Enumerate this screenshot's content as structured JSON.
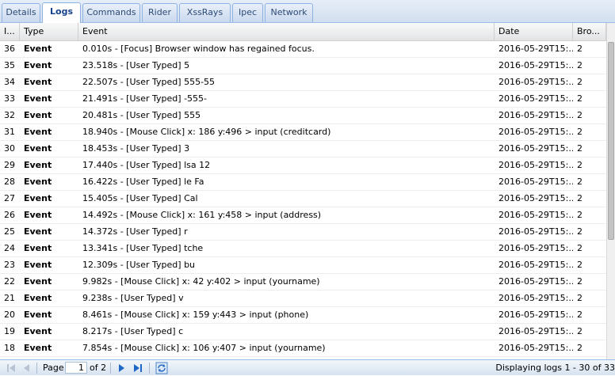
{
  "tabs": [
    {
      "label": "Details",
      "active": false
    },
    {
      "label": "Logs",
      "active": true
    },
    {
      "label": "Commands",
      "active": false
    },
    {
      "label": "Rider",
      "active": false
    },
    {
      "label": "XssRays",
      "active": false
    },
    {
      "label": "Ipec",
      "active": false
    },
    {
      "label": "Network",
      "active": false
    }
  ],
  "columns": {
    "id": "I...",
    "type": "Type",
    "event": "Event",
    "date": "Date",
    "browser": "Bro..."
  },
  "rows": [
    {
      "id": "36",
      "type": "Event",
      "event": "0.010s - [Focus] Browser window has regained focus.",
      "date": "2016-05-29T15:...",
      "browser": "2"
    },
    {
      "id": "35",
      "type": "Event",
      "event": "23.518s - [User Typed] 5",
      "date": "2016-05-29T15:...",
      "browser": "2"
    },
    {
      "id": "34",
      "type": "Event",
      "event": "22.507s - [User Typed] 555-55",
      "date": "2016-05-29T15:...",
      "browser": "2"
    },
    {
      "id": "33",
      "type": "Event",
      "event": "21.491s - [User Typed] -555-",
      "date": "2016-05-29T15:...",
      "browser": "2"
    },
    {
      "id": "32",
      "type": "Event",
      "event": "20.481s - [User Typed] 555",
      "date": "2016-05-29T15:...",
      "browser": "2"
    },
    {
      "id": "31",
      "type": "Event",
      "event": "18.940s - [Mouse Click] x: 186 y:496 > input (creditcard)",
      "date": "2016-05-29T15:...",
      "browser": "2"
    },
    {
      "id": "30",
      "type": "Event",
      "event": "18.453s - [User Typed] 3",
      "date": "2016-05-29T15:...",
      "browser": "2"
    },
    {
      "id": "29",
      "type": "Event",
      "event": "17.440s - [User Typed] lsa 12",
      "date": "2016-05-29T15:...",
      "browser": "2"
    },
    {
      "id": "28",
      "type": "Event",
      "event": "16.422s - [User Typed] le Fa",
      "date": "2016-05-29T15:...",
      "browser": "2"
    },
    {
      "id": "27",
      "type": "Event",
      "event": "15.405s - [User Typed] Cal",
      "date": "2016-05-29T15:...",
      "browser": "2"
    },
    {
      "id": "26",
      "type": "Event",
      "event": "14.492s - [Mouse Click] x: 161 y:458 > input (address)",
      "date": "2016-05-29T15:...",
      "browser": "2"
    },
    {
      "id": "25",
      "type": "Event",
      "event": "14.372s - [User Typed] r",
      "date": "2016-05-29T15:...",
      "browser": "2"
    },
    {
      "id": "24",
      "type": "Event",
      "event": "13.341s - [User Typed] tche",
      "date": "2016-05-29T15:...",
      "browser": "2"
    },
    {
      "id": "23",
      "type": "Event",
      "event": "12.309s - [User Typed] bu",
      "date": "2016-05-29T15:...",
      "browser": "2"
    },
    {
      "id": "22",
      "type": "Event",
      "event": "9.982s - [Mouse Click] x: 42 y:402 > input (yourname)",
      "date": "2016-05-29T15:...",
      "browser": "2"
    },
    {
      "id": "21",
      "type": "Event",
      "event": "9.238s - [User Typed] v",
      "date": "2016-05-29T15:...",
      "browser": "2"
    },
    {
      "id": "20",
      "type": "Event",
      "event": "8.461s - [Mouse Click] x: 159 y:443 > input (phone)",
      "date": "2016-05-29T15:...",
      "browser": "2"
    },
    {
      "id": "19",
      "type": "Event",
      "event": "8.217s - [User Typed] c",
      "date": "2016-05-29T15:...",
      "browser": "2"
    },
    {
      "id": "18",
      "type": "Event",
      "event": "7.854s - [Mouse Click] x: 106 y:407 > input (yourname)",
      "date": "2016-05-29T15:...",
      "browser": "2"
    }
  ],
  "pager": {
    "page_label": "Page",
    "page_value": "1",
    "of_label": "of 2",
    "display_text": "Displaying logs 1 - 30 of 33"
  },
  "icons": {
    "first": "first-page-icon",
    "prev": "previous-page-icon",
    "next": "next-page-icon",
    "last": "last-page-icon",
    "refresh": "refresh-icon"
  },
  "colors": {
    "accent": "#15428b",
    "tab_border": "#8db2e3",
    "pager_icon": "#1f67c4"
  }
}
